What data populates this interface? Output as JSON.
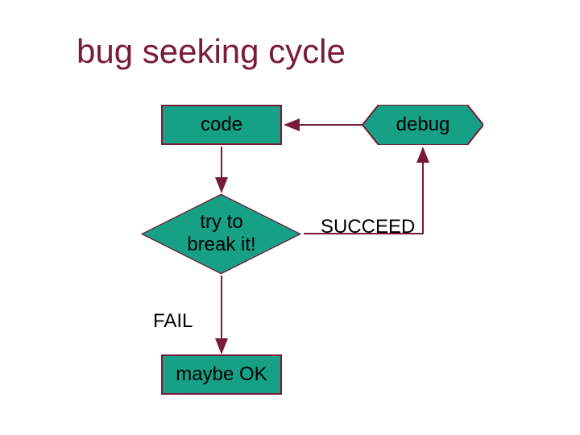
{
  "title": "bug seeking cycle",
  "nodes": {
    "code": "code",
    "debug": "debug",
    "decision": "try to\nbreak it!",
    "maybe": "maybe OK"
  },
  "edgeLabels": {
    "succeed": "SUCCEED",
    "fail": "FAIL"
  },
  "colors": {
    "shapeFill": "#16a085",
    "stroke": "#7a1a3a",
    "title": "#7a1a3a"
  }
}
